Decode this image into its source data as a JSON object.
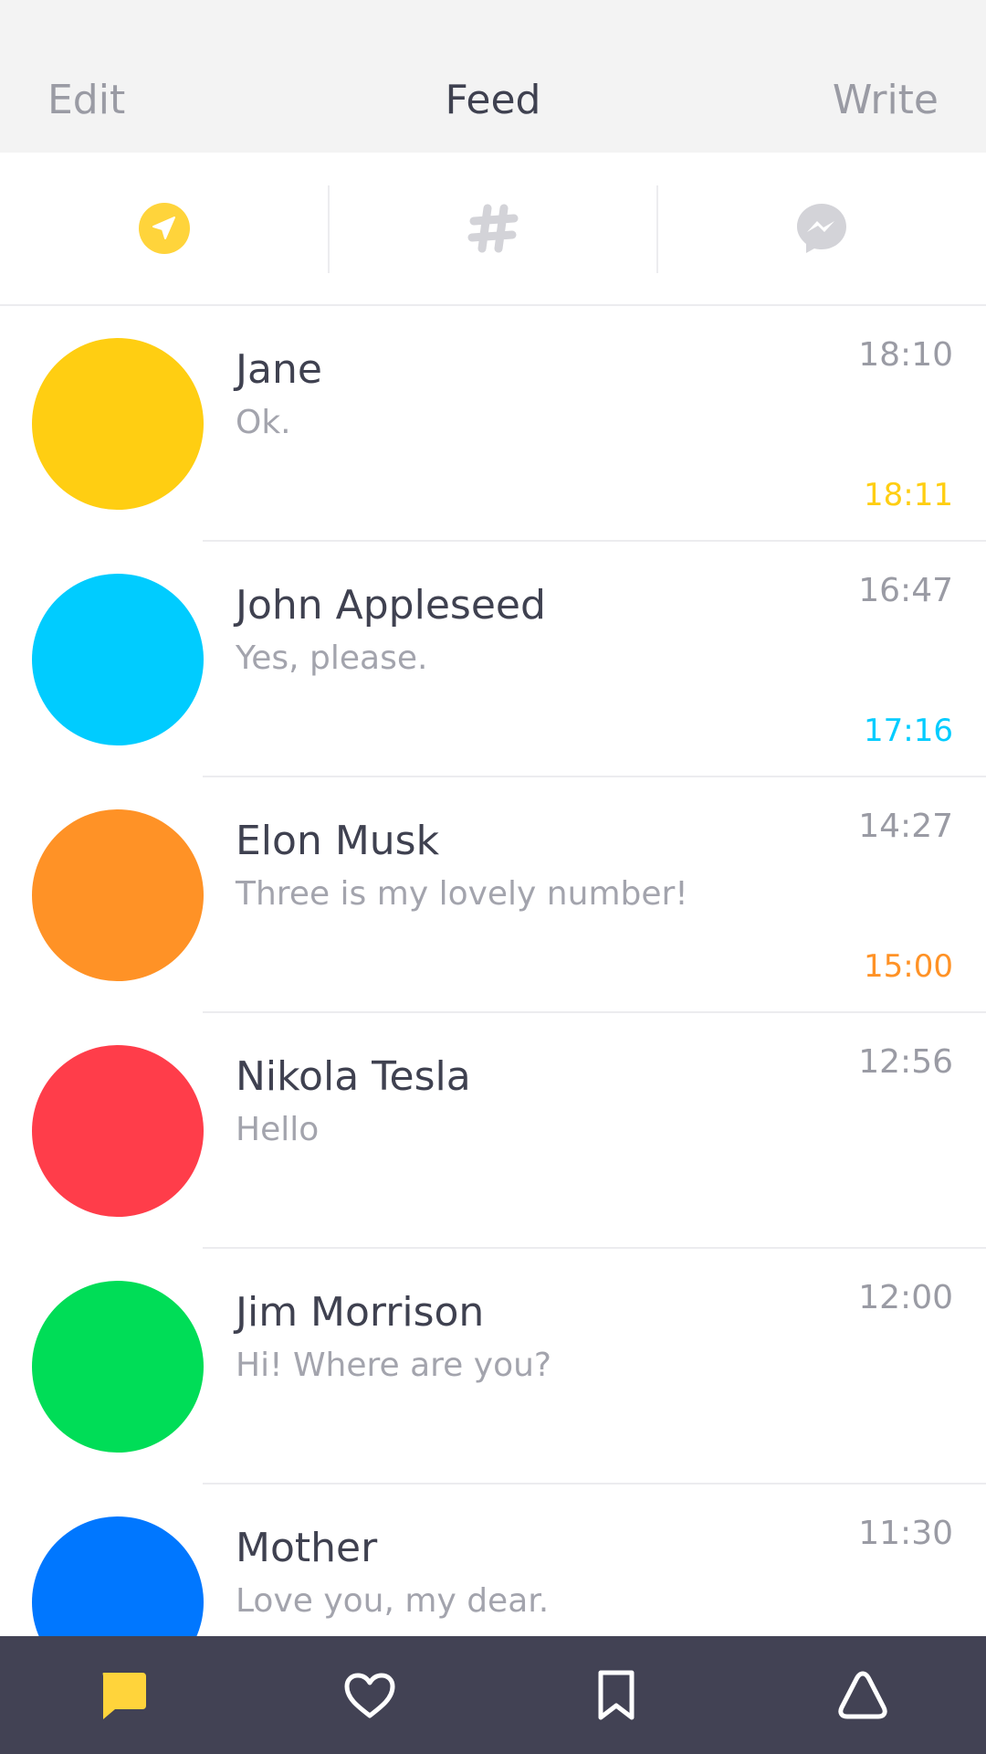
{
  "header": {
    "edit_label": "Edit",
    "title": "Feed",
    "write_label": "Write"
  },
  "segments": [
    {
      "icon": "send-icon",
      "active": true
    },
    {
      "icon": "hashtag-icon",
      "active": false
    },
    {
      "icon": "messenger-icon",
      "active": false
    }
  ],
  "conversations": [
    {
      "name": "Jane",
      "message": "Ok.",
      "time": "18:10",
      "read_time": "18:11",
      "color": "#FFCE12"
    },
    {
      "name": "John Appleseed",
      "message": "Yes, please.",
      "time": "16:47",
      "read_time": "17:16",
      "color": "#00CCFF"
    },
    {
      "name": "Elon Musk",
      "message": "Three is my lovely number!",
      "time": "14:27",
      "read_time": "15:00",
      "color": "#FF9226"
    },
    {
      "name": "Nikola Tesla",
      "message": "Hello",
      "time": "12:56",
      "read_time": "",
      "color": "#FF3D4A"
    },
    {
      "name": "Jim Morrison",
      "message": "Hi! Where are you?",
      "time": "12:00",
      "read_time": "",
      "color": "#00DD57"
    },
    {
      "name": "Mother",
      "message": "Love you, my dear.",
      "time": "11:30",
      "read_time": "",
      "color": "#0077FF"
    }
  ],
  "tabbar": [
    {
      "icon": "chat-bubble-icon",
      "active": true
    },
    {
      "icon": "heart-icon",
      "active": false
    },
    {
      "icon": "bookmark-icon",
      "active": false
    },
    {
      "icon": "bell-icon",
      "active": false
    }
  ],
  "colors": {
    "accent": "#FFD43B",
    "header_bg": "#F3F3F3",
    "tabbar_bg": "#424254",
    "inactive_icon": "#D3D3D8"
  }
}
